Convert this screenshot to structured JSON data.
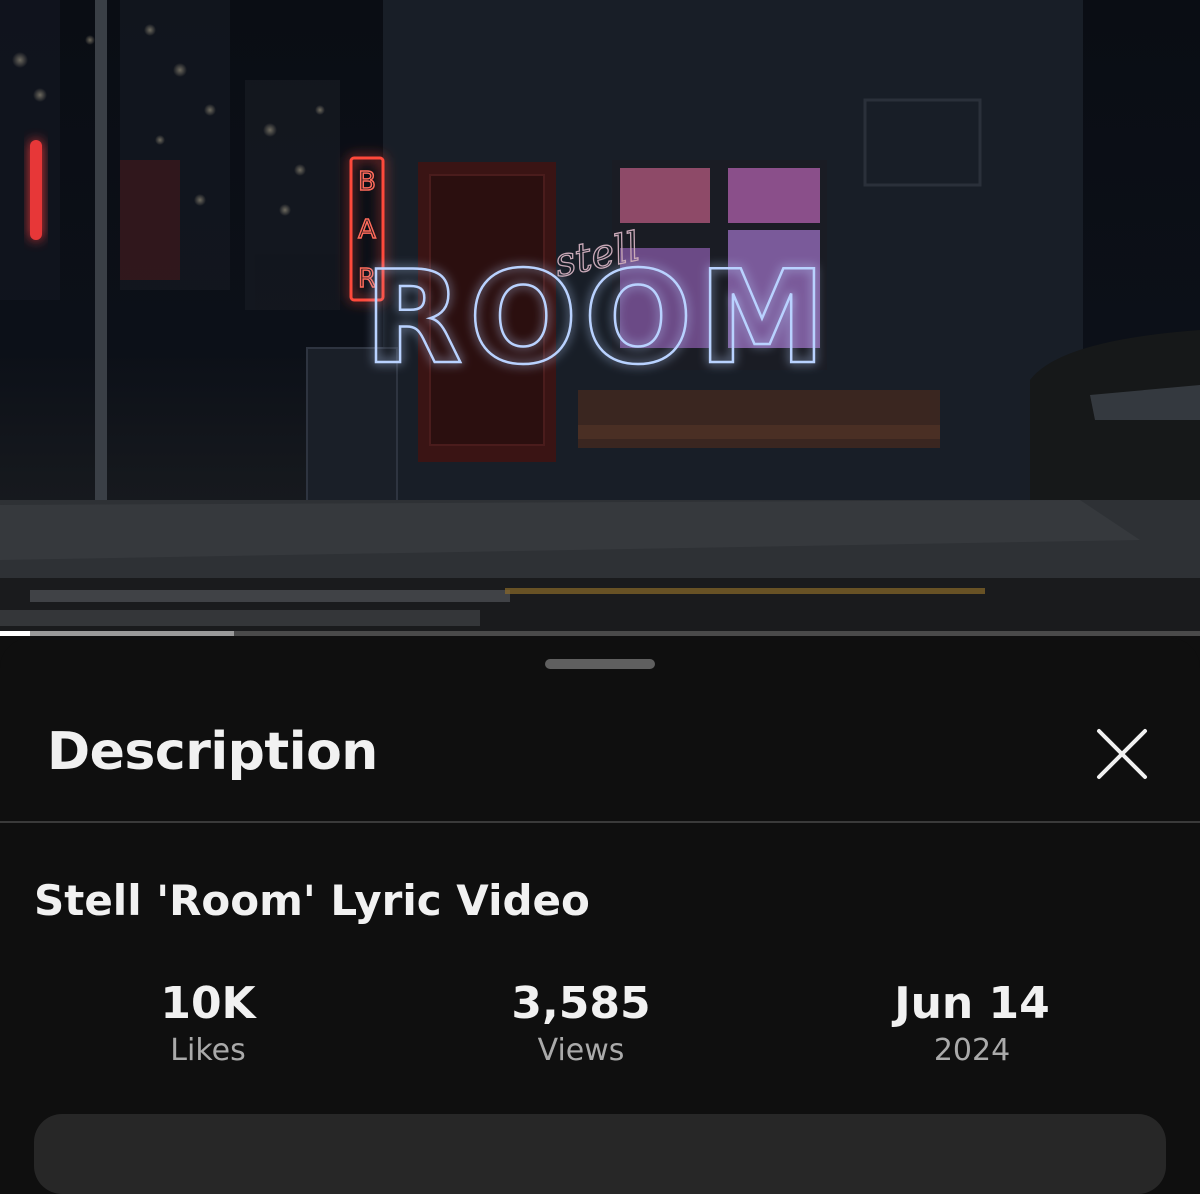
{
  "video": {
    "overlay_text": "ROOM",
    "overlay_script": "stell",
    "bar_sign": [
      "B",
      "A",
      "R"
    ],
    "progress_played": 0.025,
    "progress_buffered": 0.195
  },
  "sheet": {
    "title": "Description",
    "close_icon": "close-icon"
  },
  "description": {
    "video_title": "Stell 'Room' Lyric Video",
    "stats": [
      {
        "value": "10K",
        "label": "Likes"
      },
      {
        "value": "3,585",
        "label": "Views"
      },
      {
        "value": "Jun 14",
        "label": "2024"
      }
    ]
  },
  "colors": {
    "background": "#0f0f0f",
    "card": "#272727",
    "secondary_text": "#aaaaaa",
    "neon_red": "#ff3b3b",
    "neon_blue": "#a9c8ff"
  }
}
